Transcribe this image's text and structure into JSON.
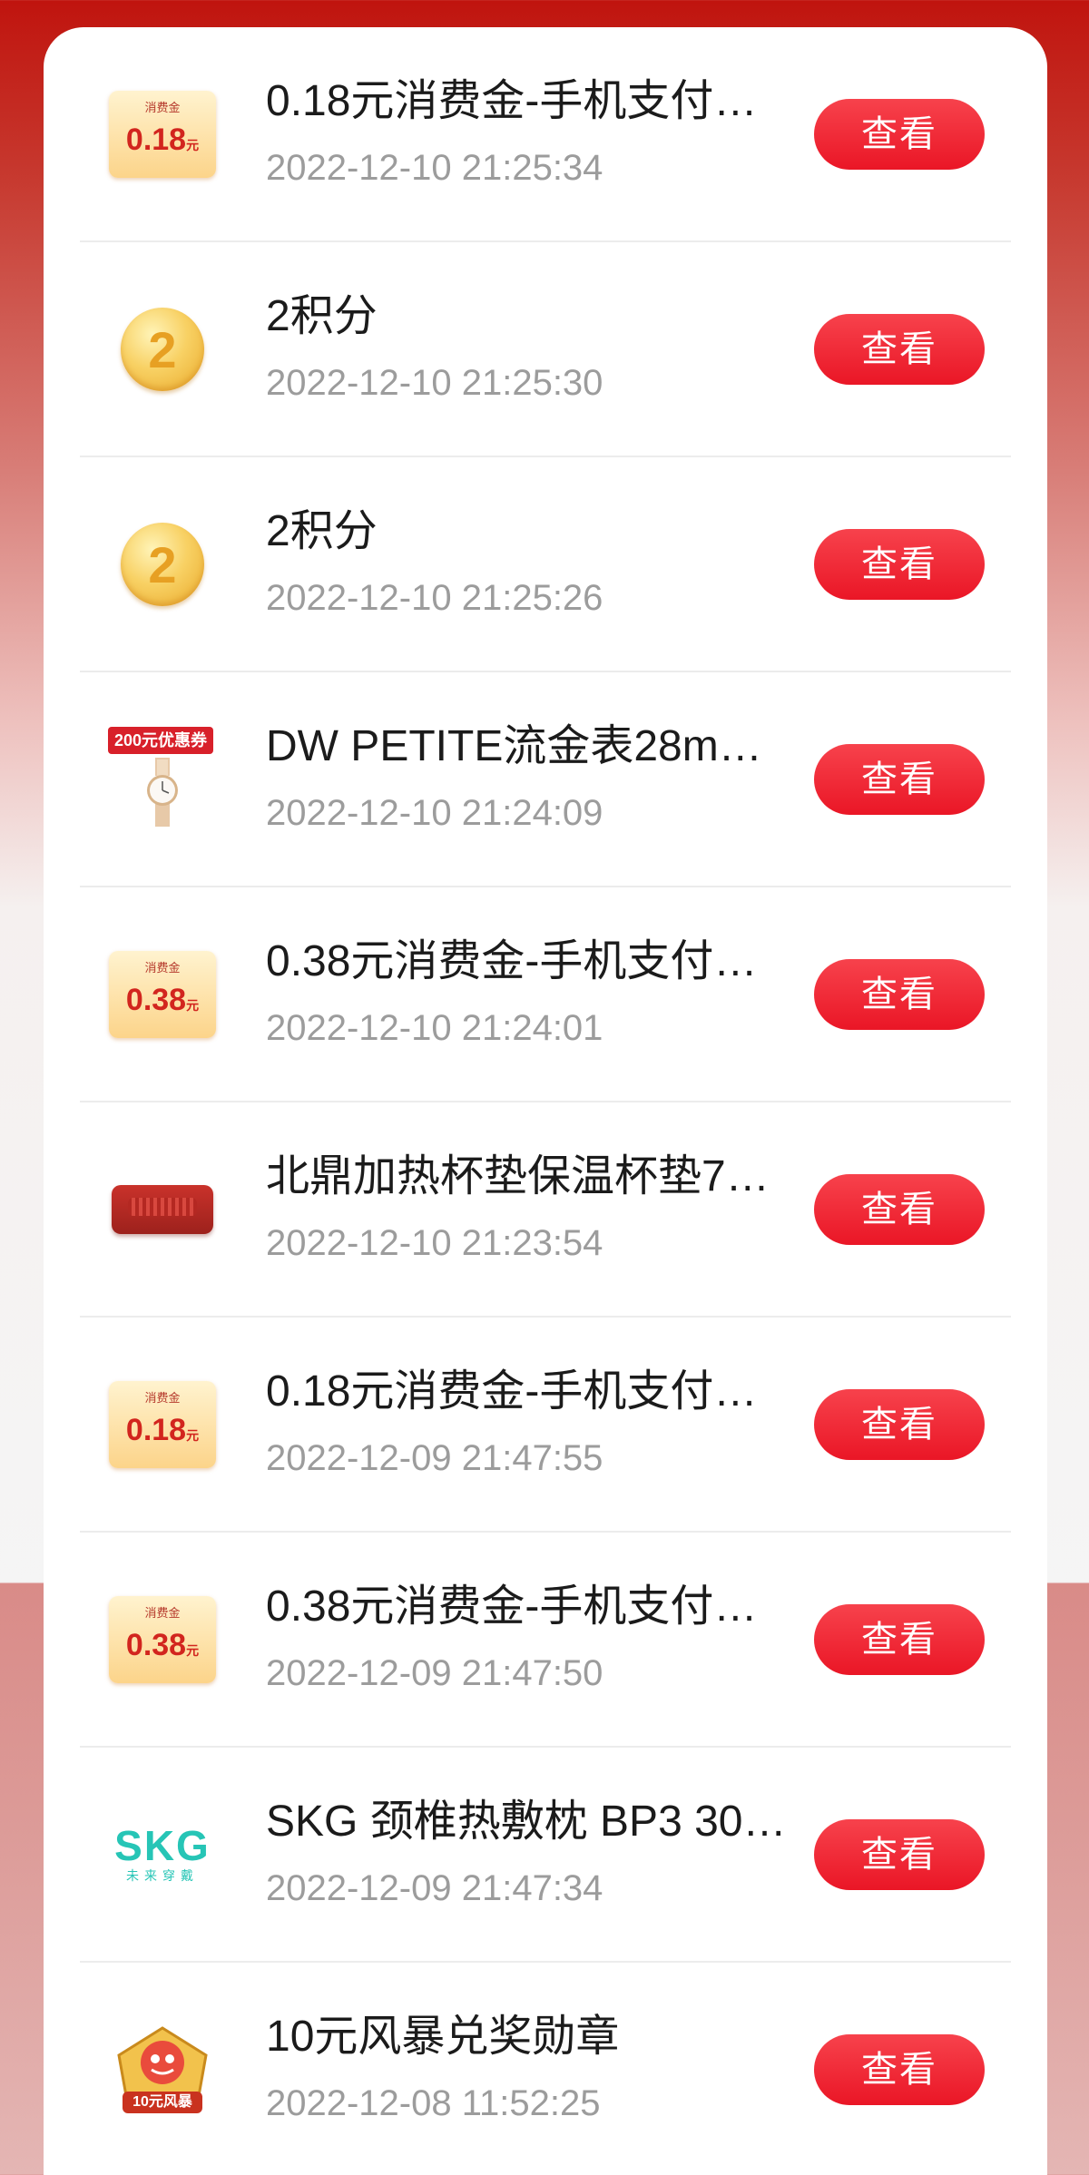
{
  "action_label": "查看",
  "items": [
    {
      "title": "0.18元消费金-手机支付…",
      "time": "2022-12-10 21:25:34",
      "icon": "consumer-gold-coupon-icon",
      "coupon_label": "消费金",
      "coupon_value": "0.18",
      "coupon_unit": "元"
    },
    {
      "title": "2积分",
      "time": "2022-12-10 21:25:30",
      "icon": "points-coin-icon",
      "coin_text": "2"
    },
    {
      "title": "2积分",
      "time": "2022-12-10 21:25:26",
      "icon": "points-coin-icon",
      "coin_text": "2"
    },
    {
      "title": "DW PETITE流金表28m…",
      "time": "2022-12-10 21:24:09",
      "icon": "watch-product-icon",
      "tag_text": "200元优惠券"
    },
    {
      "title": "0.38元消费金-手机支付…",
      "time": "2022-12-10 21:24:01",
      "icon": "consumer-gold-coupon-icon",
      "coupon_label": "消费金",
      "coupon_value": "0.38",
      "coupon_unit": "元"
    },
    {
      "title": "北鼎加热杯垫保温杯垫7…",
      "time": "2022-12-10 21:23:54",
      "icon": "cup-warmer-product-icon"
    },
    {
      "title": "0.18元消费金-手机支付…",
      "time": "2022-12-09 21:47:55",
      "icon": "consumer-gold-coupon-icon",
      "coupon_label": "消费金",
      "coupon_value": "0.18",
      "coupon_unit": "元"
    },
    {
      "title": "0.38元消费金-手机支付…",
      "time": "2022-12-09 21:47:50",
      "icon": "consumer-gold-coupon-icon",
      "coupon_label": "消费金",
      "coupon_value": "0.38",
      "coupon_unit": "元"
    },
    {
      "title": "SKG 颈椎热敷枕 BP3 30…",
      "time": "2022-12-09 21:47:34",
      "icon": "skg-logo-icon",
      "logo_main": "SKG",
      "logo_sub": "未来穿戴"
    },
    {
      "title": "10元风暴兑奖勋章",
      "time": "2022-12-08 11:52:25",
      "icon": "storm-medal-icon",
      "medal_text": "10元风暴"
    }
  ],
  "colors": {
    "accent_red": "#ea1626",
    "title_text": "#1b1b1b",
    "time_text": "#9c9c9c",
    "skg_teal": "#26c5b6"
  }
}
